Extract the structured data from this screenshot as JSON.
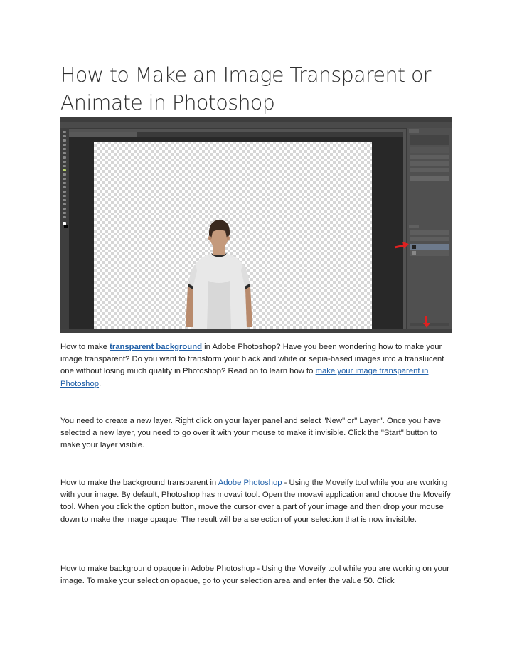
{
  "article": {
    "title": "How to Make an Image Transparent or Animate in Photoshop",
    "paragraphs": [
      {
        "t1": "How to make ",
        "link1": "transparent background",
        "t2": " in Adobe Photoshop? Have you been wondering how to make your image transparent? Do you want to transform your black and white or sepia-based images into a translucent one without losing much quality in Photoshop? Read on to learn how to ",
        "link2": "make your image transparent in Photoshop",
        "t3": "."
      },
      {
        "text": "You need to create a new layer. Right click on your layer panel and select \"New\" or\" Layer\". Once you have selected a new layer, you need to go over it with your mouse to make it invisible. Click the \"Start\" button to make your layer visible."
      },
      {
        "t1": "How to make the background transparent in ",
        "link1": "Adobe Photoshop",
        "t2": " - Using the Moveify tool while you are working with your image. By default, Photoshop has movavi tool. Open the movavi application and choose the Moveify tool. When you click the option button, move the cursor over a part of your image and then drop your mouse down to make the image opaque. The result will be a selection of your selection that is now invisible."
      },
      {
        "text": "How to make background opaque in Adobe Photoshop - Using the Moveify tool while you are working on your image. To make your selection opaque, go to your selection area and enter the value 50. Click"
      }
    ]
  },
  "screenshot": {
    "colors": {
      "ui_dark": "#3e3e3e",
      "ui_mid": "#535353",
      "canvas_check": "#d6d6d6",
      "arrow": "#e02020",
      "shirt": "#e8e8e8",
      "hair": "#3a2a20",
      "skin": "#c49a7c"
    },
    "icons": [
      "photoshop-toolbar-icons",
      "red-arrow-icon"
    ]
  }
}
